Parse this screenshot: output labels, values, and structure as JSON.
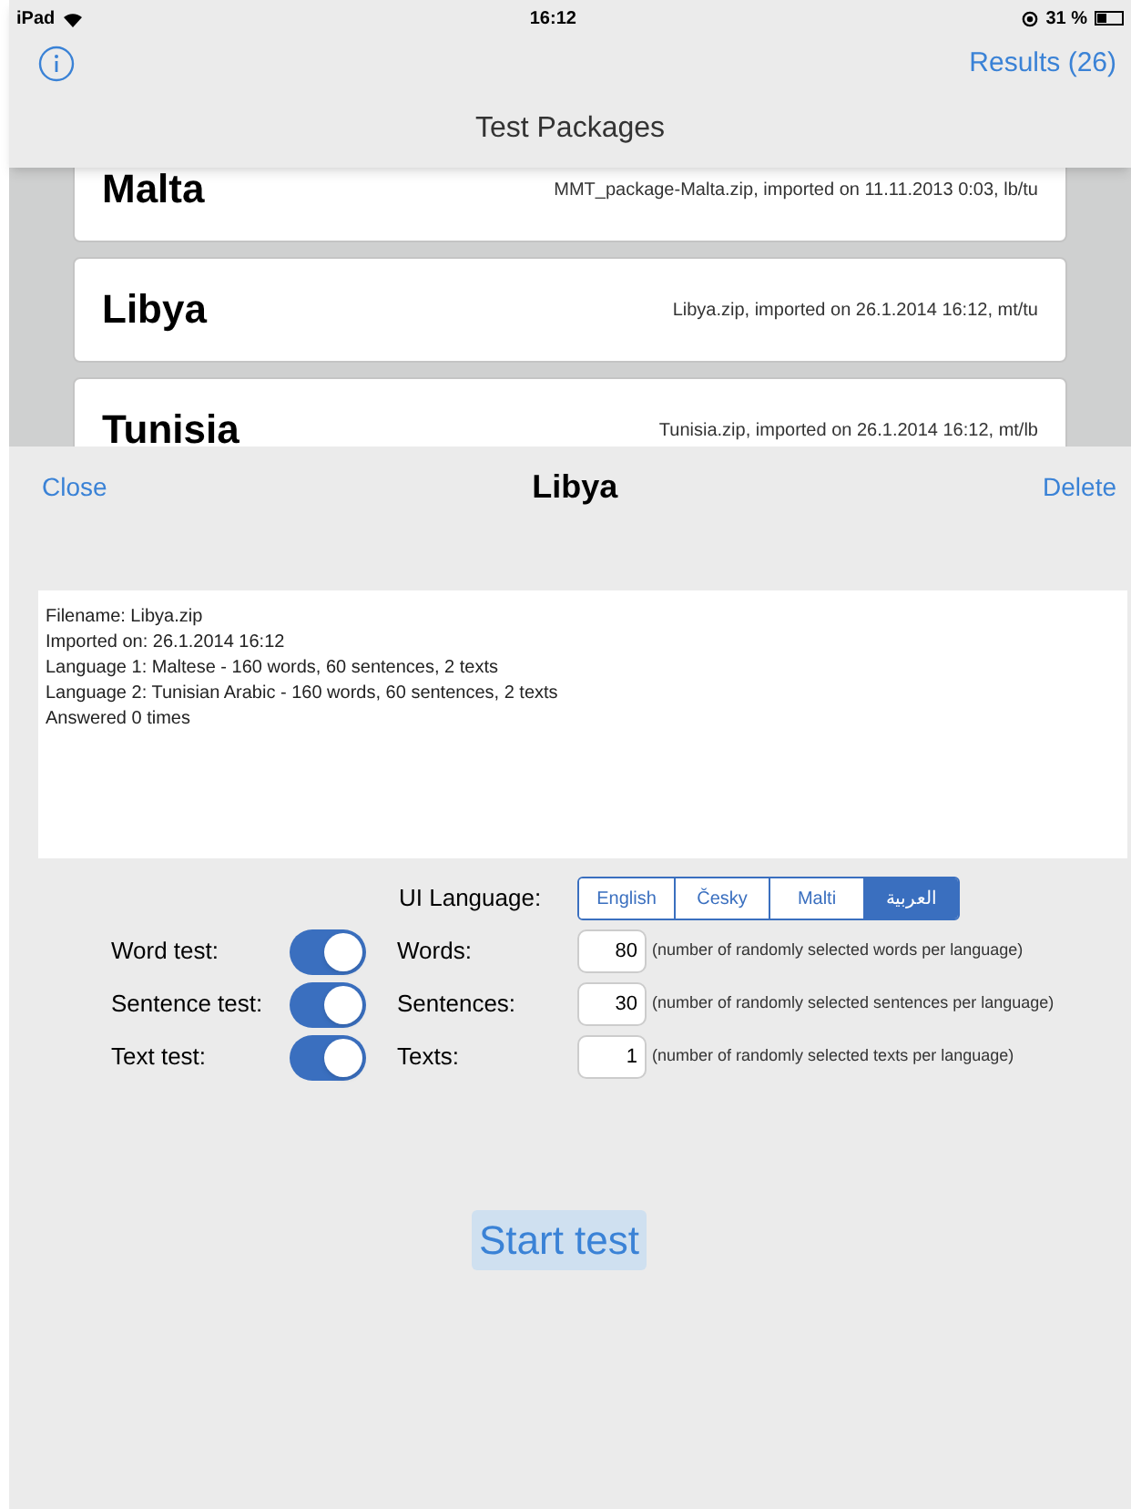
{
  "status_bar": {
    "device": "iPad",
    "time": "16:12",
    "battery": "31 %"
  },
  "nav_bar": {
    "title": "Test Packages",
    "results_button": "Results (26)"
  },
  "packages": [
    {
      "name": "Malta",
      "info": "MMT_package-Malta.zip, imported on 11.11.2013 0:03, lb/tu"
    },
    {
      "name": "Libya",
      "info": "Libya.zip, imported on 26.1.2014 16:12, mt/tu"
    },
    {
      "name": "Tunisia",
      "info": "Tunisia.zip, imported on 26.1.2014 16:12, mt/lb"
    }
  ],
  "sheet": {
    "title": "Libya",
    "close_button": "Close",
    "delete_button": "Delete",
    "details": [
      "Filename: Libya.zip",
      "Imported on: 26.1.2014 16:12",
      "Language 1: Maltese - 160 words, 60 sentences, 2 texts",
      "Language 2: Tunisian Arabic - 160 words, 60 sentences, 2 texts",
      "Answered 0 times"
    ],
    "ui_language": {
      "label": "UI Language:",
      "options": [
        {
          "label": "English",
          "selected": false
        },
        {
          "label": "Česky",
          "selected": false
        },
        {
          "label": "Malti",
          "selected": false
        },
        {
          "label": "العربية",
          "selected": true
        }
      ]
    },
    "tests": [
      {
        "label": "Word test:",
        "on": true,
        "count_label": "Words:",
        "count": "80",
        "hint": "(number of randomly selected words per language)"
      },
      {
        "label": "Sentence test:",
        "on": true,
        "count_label": "Sentences:",
        "count": "30",
        "hint": "(number of randomly selected sentences per language)"
      },
      {
        "label": "Text test:",
        "on": true,
        "count_label": "Texts:",
        "count": "1",
        "hint": "(number of randomly selected texts per language)"
      }
    ],
    "start_button": "Start test"
  }
}
